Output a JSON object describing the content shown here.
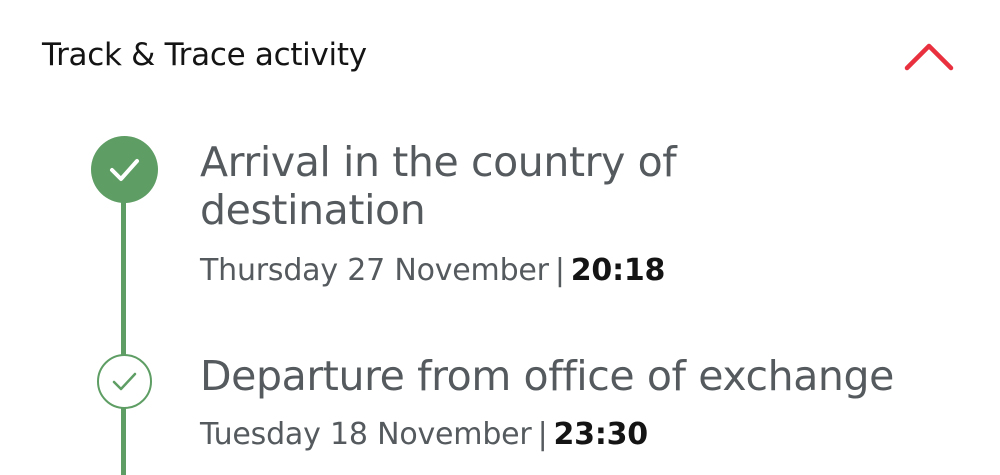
{
  "header": {
    "title": "Track & Trace activity"
  },
  "colors": {
    "accent_red": "#e8303f",
    "timeline_green": "#5e9e64",
    "text_gray": "#555a5e",
    "text_dark": "#141414"
  },
  "icons": {
    "collapse": "chevron-up-icon",
    "completed": "check-icon"
  },
  "events": [
    {
      "title": "Arrival in the country of destination",
      "date": "Thursday 27 November",
      "separator": "|",
      "time": "20:18",
      "state": "current"
    },
    {
      "title": "Departure from office of exchange",
      "date": "Tuesday 18 November",
      "separator": "|",
      "time": "23:30",
      "state": "completed"
    }
  ]
}
